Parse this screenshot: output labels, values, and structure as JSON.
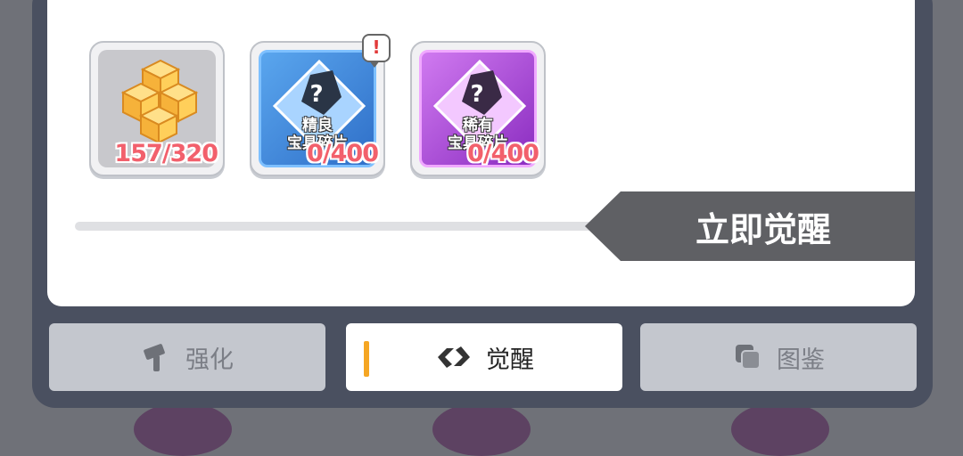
{
  "items": [
    {
      "count": "157/320",
      "kind": "material-blocks"
    },
    {
      "count": "0/400",
      "label_line1": "精良",
      "label_line2": "宝具碎片",
      "rarity_color": "#3a8fe0"
    },
    {
      "count": "0/400",
      "label_line1": "稀有",
      "label_line2": "宝具碎片",
      "rarity_color": "#b64ee0"
    }
  ],
  "alert_mark": "!",
  "awaken_button": {
    "label": "立即觉醒"
  },
  "tabs": [
    {
      "label": "强化",
      "icon": "hammer-icon",
      "active": false
    },
    {
      "label": "觉醒",
      "icon": "chain-link-icon",
      "active": true
    },
    {
      "label": "图鉴",
      "icon": "cards-icon",
      "active": false
    }
  ],
  "colors": {
    "accent": "#f5a623",
    "count_text": "#f2606c",
    "button_bg": "#5f6064"
  }
}
